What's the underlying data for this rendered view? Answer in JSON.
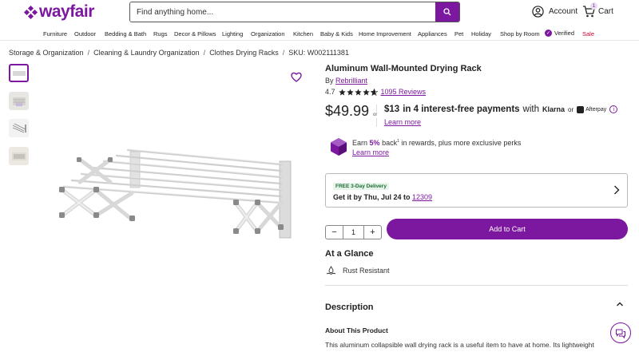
{
  "header": {
    "logo_text": "wayfair",
    "search_placeholder": "Find anything home...",
    "account_label": "Account",
    "cart_label": "Cart",
    "cart_count": "1"
  },
  "nav": {
    "items": [
      "Furniture",
      "Outdoor",
      "Bedding & Bath",
      "Rugs",
      "Decor & Pillows",
      "Lighting",
      "Organization",
      "Kitchen",
      "Baby & Kids",
      "Home Improvement",
      "Appliances",
      "Pet",
      "Holiday",
      "Shop by Room",
      "Verified",
      "Sale"
    ]
  },
  "breadcrumb": {
    "items": [
      "Storage & Organization",
      "Cleaning & Laundry Organization",
      "Clothes Drying Racks",
      "SKU: W002111381"
    ]
  },
  "product": {
    "title": "Aluminum Wall-Mounted Drying Rack",
    "by_label": "By",
    "brand": "Rebrilliant",
    "rating": "4.7",
    "reviews": "1095 Reviews",
    "price": "$49.99",
    "or_label": "or",
    "installment_amount": "$13",
    "installment_text": "in 4 interest-free payments",
    "installment_with": "with",
    "klarna": "Klarna",
    "afterpay_or": "or",
    "afterpay": "Afterpay",
    "learn_more": "Learn more"
  },
  "rewards": {
    "text_prefix": "Earn",
    "percent": "5%",
    "text_mid": "back",
    "superscript": "1",
    "text_suffix": "in rewards, plus more exclusive perks",
    "learn_more": "Learn more"
  },
  "delivery": {
    "badge": "FREE 3-Day Delivery",
    "text_prefix": "Get it by Thu, Jul 24 to",
    "zip": "12309"
  },
  "purchase": {
    "quantity": "1",
    "add_to_cart": "Add to Cart"
  },
  "glance": {
    "heading": "At a Glance",
    "feature": "Rust Resistant"
  },
  "description": {
    "heading": "Description",
    "about_heading": "About This Product",
    "body": "This aluminum collapsible wall drying rack is a useful item to have at home. Its lightweight"
  },
  "colors": {
    "brand": "#7b189f",
    "sale": "#c7002f"
  }
}
